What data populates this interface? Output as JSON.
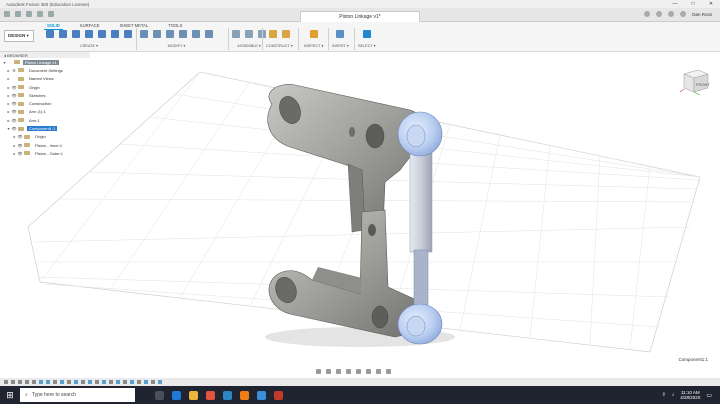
{
  "window": {
    "title": "Autodesk Fusion 360 (Education License)",
    "controls": [
      "—",
      "□",
      "✕"
    ]
  },
  "document_tab": {
    "title": "Piston Linkage v1*"
  },
  "user": {
    "name": "Dan Ross"
  },
  "ribbon": {
    "tabs": [
      "SOLID",
      "SURFACE",
      "SHEET METAL",
      "TOOLS"
    ],
    "active_tab": "SOLID",
    "workspace": "DESIGN ▾",
    "groups": [
      "CREATE ▾",
      "MODIFY ▾",
      "ASSEMBLE ▾",
      "CONSTRUCT ▾",
      "INSPECT ▾",
      "INSERT ▾",
      "SELECT ▾"
    ]
  },
  "browser": {
    "header": "◂ BROWSER",
    "nodes": [
      {
        "label": "Piston Linkage v1",
        "eye": "",
        "state": "sel",
        "arrow": "▾"
      },
      {
        "label": "Document Settings",
        "eye": "⚙",
        "state": "",
        "arrow": "▸"
      },
      {
        "label": "Named Views",
        "eye": "",
        "state": "",
        "arrow": "▸"
      },
      {
        "label": "Origin",
        "eye": "👁",
        "state": "",
        "arrow": "▸"
      },
      {
        "label": "Sketches",
        "eye": "👁",
        "state": "",
        "arrow": "▸"
      },
      {
        "label": "Construction",
        "eye": "👁",
        "state": "",
        "arrow": "▸"
      },
      {
        "label": "Arm (1):1",
        "eye": "👁",
        "state": "",
        "arrow": "▸"
      },
      {
        "label": "Arm:1",
        "eye": "👁",
        "state": "",
        "arrow": "▸"
      },
      {
        "label": "Component1:1",
        "eye": "👁",
        "state": "active",
        "arrow": "▾"
      },
      {
        "label": "Origin",
        "eye": "👁",
        "state": "",
        "arrow": "▸"
      },
      {
        "label": "Piston - Inner:1",
        "eye": "👁",
        "state": "",
        "arrow": "▸"
      },
      {
        "label": "Piston - Outer:1",
        "eye": "👁",
        "state": "",
        "arrow": "▸"
      }
    ]
  },
  "viewcube": {
    "face": "FRONT"
  },
  "status": {
    "component": "Component1:1"
  },
  "taskbar": {
    "search_placeholder": "Type here to search",
    "time": "11:10 AM",
    "date": "4/28/2020"
  }
}
